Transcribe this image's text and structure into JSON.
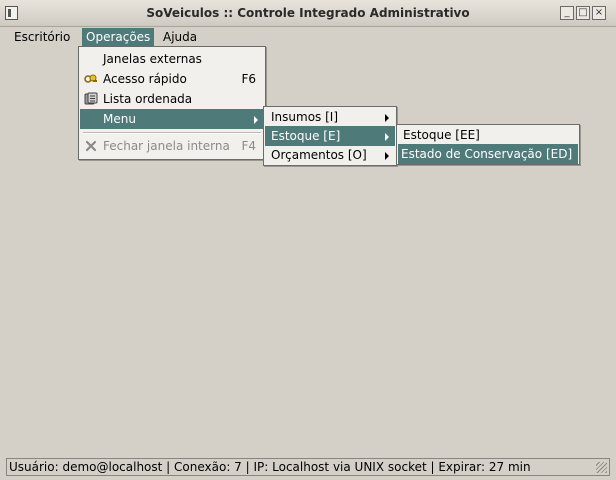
{
  "window": {
    "title": "SoVeiculos :: Controle Integrado Administrativo",
    "controls": {
      "minimize": "_",
      "maximize": "□",
      "close": "×"
    }
  },
  "menubar": {
    "items": [
      {
        "label": "Escritório",
        "mnemonic": "E"
      },
      {
        "label": "Operações",
        "mnemonic": "O",
        "active": true
      },
      {
        "label": "Ajuda",
        "mnemonic": "j"
      }
    ]
  },
  "operacoes_menu": {
    "items": [
      {
        "label": "Janelas externas",
        "shortcut": "",
        "icon": "none"
      },
      {
        "label": "Acesso rápido",
        "shortcut": "F6",
        "icon": "keys-icon"
      },
      {
        "label": "Lista ordenada",
        "shortcut": "",
        "icon": "list-icon"
      },
      {
        "label": "Menu",
        "shortcut": "",
        "icon": "none",
        "submenu": true,
        "highlighted": true
      },
      {
        "label": "Fechar janela interna",
        "shortcut": "F4",
        "icon": "close-x-icon",
        "disabled": true
      }
    ]
  },
  "menu_submenu": {
    "items": [
      {
        "label": "Insumos [I]"
      },
      {
        "label": "Estoque [E]",
        "highlighted": true
      },
      {
        "label": "Orçamentos [O]"
      }
    ]
  },
  "estoque_submenu": {
    "items": [
      {
        "label": "Estoque [EE]"
      },
      {
        "label": "Estado de Conservação [ED]",
        "highlighted": true
      }
    ]
  },
  "statusbar": {
    "text": "Usuário: demo@localhost  |  Conexão: 7  |  IP: Localhost via UNIX socket | Expirar: 27 min"
  },
  "colors": {
    "highlight": "#4f7a7a",
    "background": "#d4d0c8",
    "menu_background": "#f2f0ec"
  }
}
